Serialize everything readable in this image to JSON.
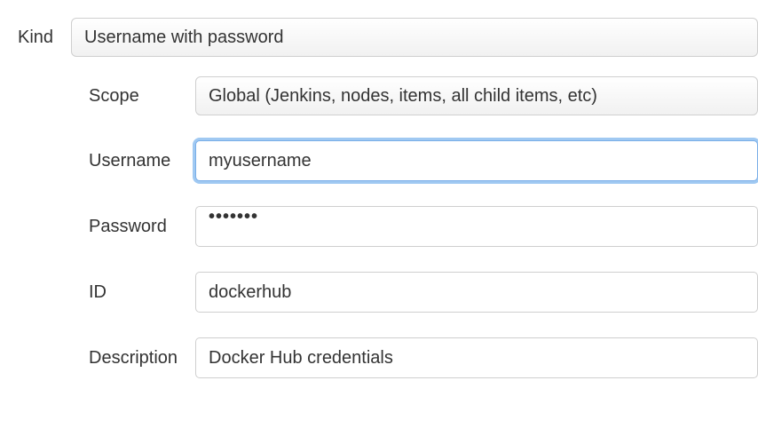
{
  "labels": {
    "kind": "Kind",
    "scope": "Scope",
    "username": "Username",
    "password": "Password",
    "id": "ID",
    "description": "Description"
  },
  "values": {
    "kind": "Username with password",
    "scope": "Global (Jenkins, nodes, items, all child items, etc)",
    "username": "myusername",
    "password": "•••••••",
    "id": "dockerhub",
    "description": "Docker Hub credentials"
  }
}
